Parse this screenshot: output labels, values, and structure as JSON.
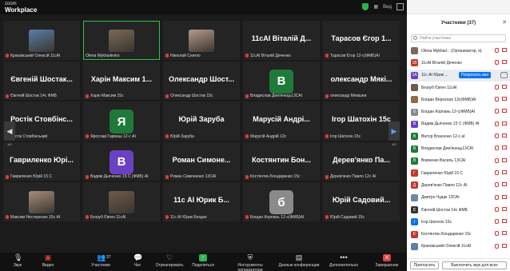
{
  "brand": {
    "line1": "zoom",
    "line2": "Workplace"
  },
  "topbar": {
    "view_label": "Вид"
  },
  "tiles": [
    {
      "name": "Краковський Олексій 11сАІ",
      "type": "photo",
      "color": "#5a7fa8"
    },
    {
      "name": "Olena Mykhailenko",
      "type": "photo",
      "color": "#7a6a55",
      "active": true
    },
    {
      "name": "Николай Снитко",
      "type": "photo",
      "color": "#b59a8a"
    },
    {
      "name": "11сАІ Віталій Дяченко",
      "big": "11сАІ Віталій Д...",
      "type": "text"
    },
    {
      "name": "Тарасов Єгор 12-с(ФМБ)АІ",
      "big": "Тарасов Єгор 1...",
      "type": "text"
    },
    {
      "name": "Євгеній Шостак 14с ФМБ",
      "big": "Євгеній Шостак...",
      "type": "text"
    },
    {
      "name": "Харін Максим 15с",
      "big": "Харін Максим 1...",
      "type": "text"
    },
    {
      "name": "Олександр Шостак 15с",
      "big": "Олександр Шост...",
      "type": "text"
    },
    {
      "name": "Владислав Дем'янець13САІ",
      "type": "letter",
      "letter": "В",
      "color": "#1f7a3a"
    },
    {
      "name": "олександр Мякішев",
      "big": "олександр Мякі...",
      "type": "text"
    },
    {
      "name": "Ростік Стовбінський",
      "big": "Ростік Стовбінс...",
      "type": "text"
    },
    {
      "name": "Ярослав Гармаш 12-с АІ",
      "type": "letter",
      "letter": "Я",
      "color": "#1f7a3a"
    },
    {
      "name": "Юрій Заруба",
      "big": "Юрій Заруба",
      "type": "text"
    },
    {
      "name": "Марусій Андрій 12с",
      "big": "Марусій Андрі...",
      "type": "text"
    },
    {
      "name": "Ігор Шатохін 15с",
      "big": "Ігор Шатохін 15с",
      "type": "text"
    },
    {
      "name": "Гавриленко Юрій 15 С",
      "big": "Гавриленко Юрі...",
      "type": "text"
    },
    {
      "name": "Вадим Дьяченко 15 С (ФМБ) АІ",
      "type": "letter",
      "letter": "В",
      "color": "#6b41c4"
    },
    {
      "name": "Роман Симоненко 13САІ",
      "big": "Роман Симоне...",
      "type": "text"
    },
    {
      "name": "Костянтин Бондаренко 15с",
      "big": "Костянтин Бон...",
      "type": "text"
    },
    {
      "name": "Дерев'янко Павло 12с АІ",
      "big": "Дерев'янко Па...",
      "type": "text"
    },
    {
      "name": "Максим Нестеренко 15с АІ",
      "type": "photo",
      "color": "#a78d7a"
    },
    {
      "name": "Беззуб Євген 11сАІ",
      "type": "photo",
      "color": "#6e5b48"
    },
    {
      "name": "11с АІ Юрик Богдан",
      "big": "11с АІ Юрик Б...",
      "type": "text"
    },
    {
      "name": "Богдан Корпань 12-с(ФМБ)АІ",
      "type": "letter",
      "letter": "б",
      "color": "#8a8a8a"
    },
    {
      "name": "Юрій Садовий 15с",
      "big": "Юрій Садовий...",
      "type": "text"
    },
    {
      "name": "",
      "type": "empty"
    },
    {
      "name": "",
      "type": "empty"
    },
    {
      "name": "",
      "type": "empty"
    },
    {
      "name": "",
      "type": "empty"
    },
    {
      "name": "",
      "type": "empty"
    }
  ],
  "nav": {
    "left_page": "1/2",
    "right_page": "1/2",
    "left_arrow": "◀",
    "right_arrow": "▶"
  },
  "toolbar": {
    "audio": "Звук",
    "video": "Видео",
    "participants": "Участники",
    "participants_count": "37",
    "chat": "Чат",
    "react": "Отреагировать",
    "share": "Поделиться",
    "host_tools": "Инструменты организатора",
    "meeting_data": "Данные конференции",
    "more": "Дополнительно",
    "end": "Завершение"
  },
  "panel": {
    "title": "Участники (37)",
    "search_placeholder": "Найти участника",
    "ask_button": "Попросить вкл",
    "invite": "Пригласить",
    "mute_all": "Выключить звук для всех",
    "participants": [
      {
        "initials": "",
        "name": "Olena Mykhail... (Организатор, я)",
        "color": "#7a6a55"
      },
      {
        "initials": "1В",
        "name": "11сАІ Віталій Дяченко",
        "color": "#c0392b"
      },
      {
        "initials": "1А",
        "name": "11с АІ Юрик ...",
        "color": "#6b41c4",
        "highlight": true
      },
      {
        "initials": "",
        "name": "Беззуб Євген 11сАІ",
        "color": "#6e5b48"
      },
      {
        "initials": "",
        "name": "Богдан Верхолая 13с(ФМБ)АІ",
        "color": "#8a6b50"
      },
      {
        "initials": "б",
        "name": "Богдан Корпань 12-с(ФМБ)АІ",
        "color": "#8a8a8a"
      },
      {
        "initials": "В",
        "name": "Вадим Дьяченко 15 С (ФМБ) АІ",
        "color": "#6b41c4"
      },
      {
        "initials": "В",
        "name": "Віктор Власенко 12-с.аІ",
        "color": "#1f7a3a"
      },
      {
        "initials": "В",
        "name": "Владислав Дем'янець13САІ",
        "color": "#1f7a3a"
      },
      {
        "initials": "В",
        "name": "Вовченко Василь 13САІ",
        "color": "#1f7a3a"
      },
      {
        "initials": "Г",
        "name": "Гавриленко Юрій 15 С",
        "color": "#c0392b"
      },
      {
        "initials": "Д",
        "name": "Дерев'янко Павло 12с АІ",
        "color": "#c0392b"
      },
      {
        "initials": "",
        "name": "Дмитро Чудак 13САІ",
        "color": "#6f8aa0"
      },
      {
        "initials": "Є",
        "name": "Євгеній Шостак 14с ФМБ",
        "color": "#333"
      },
      {
        "initials": "І",
        "name": "Ігор Шатохін 15с",
        "color": "#0e71eb"
      },
      {
        "initials": "К",
        "name": "Костянтин Бондаренко 15с",
        "color": "#c0392b"
      },
      {
        "initials": "",
        "name": "Краковський Олексій 11сАІ",
        "color": "#5a7fa8"
      }
    ]
  }
}
